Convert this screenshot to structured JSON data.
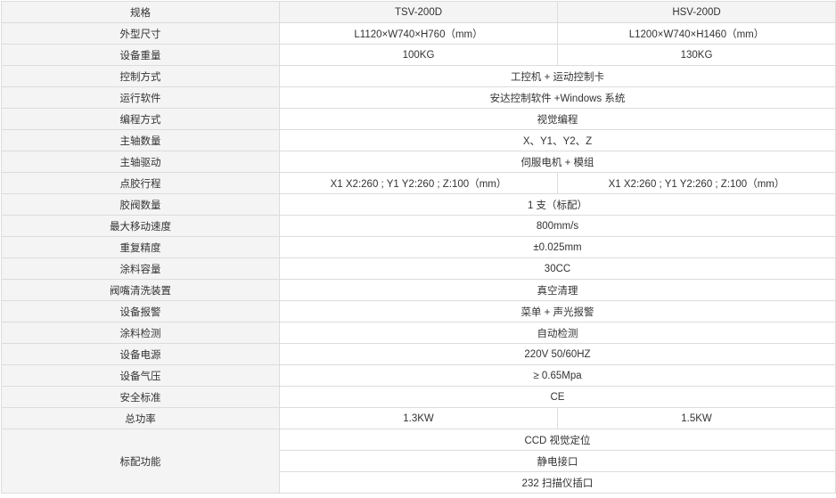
{
  "headers": [
    "规格",
    "TSV-200D",
    "HSV-200D"
  ],
  "rows": {
    "dimensions": {
      "label": "外型尺寸",
      "tsv": "L1120×W740×H760（mm）",
      "hsv": "L1200×W740×H1460（mm）"
    },
    "weight": {
      "label": "设备重量",
      "tsv": "100KG",
      "hsv": "130KG"
    },
    "control": {
      "label": "控制方式",
      "value": "工控机 + 运动控制卡"
    },
    "software": {
      "label": "运行软件",
      "value": "安达控制软件 +Windows 系统"
    },
    "programming": {
      "label": "编程方式",
      "value": "视觉编程"
    },
    "axis_count": {
      "label": "主轴数量",
      "value": "X、Y1、Y2、Z"
    },
    "axis_drive": {
      "label": "主轴驱动",
      "value": "伺服电机 + 模组"
    },
    "dispense_travel": {
      "label": "点胶行程",
      "tsv": "X1 X2:260 ; Y1 Y2:260 ; Z:100（mm）",
      "hsv": "X1 X2:260 ; Y1 Y2:260 ; Z:100（mm）"
    },
    "valve_count": {
      "label": "胶阀数量",
      "value": "1 支（标配）"
    },
    "max_speed": {
      "label": "最大移动速度",
      "value": "800mm/s"
    },
    "repeatability": {
      "label": "重复精度",
      "value": "±0.025mm"
    },
    "coating_capacity": {
      "label": "涂料容量",
      "value": "30CC"
    },
    "nozzle_cleaning": {
      "label": "阀嘴清洗装置",
      "value": "真空清理"
    },
    "alarm": {
      "label": "设备报警",
      "value": "菜单 + 声光报警"
    },
    "coating_detection": {
      "label": "涂料检测",
      "value": "自动检测"
    },
    "power_supply": {
      "label": "设备电源",
      "value": "220V 50/60HZ"
    },
    "air_pressure": {
      "label": "设备气压",
      "value": "≥ 0.65Mpa"
    },
    "safety_standard": {
      "label": "安全标准",
      "value": "CE"
    },
    "total_power": {
      "label": "总功率",
      "tsv": "1.3KW",
      "hsv": "1.5KW"
    },
    "standard_features": {
      "label": "标配功能",
      "items": [
        "CCD 视觉定位",
        "静电接口",
        "232 扫描仪插口"
      ]
    }
  }
}
